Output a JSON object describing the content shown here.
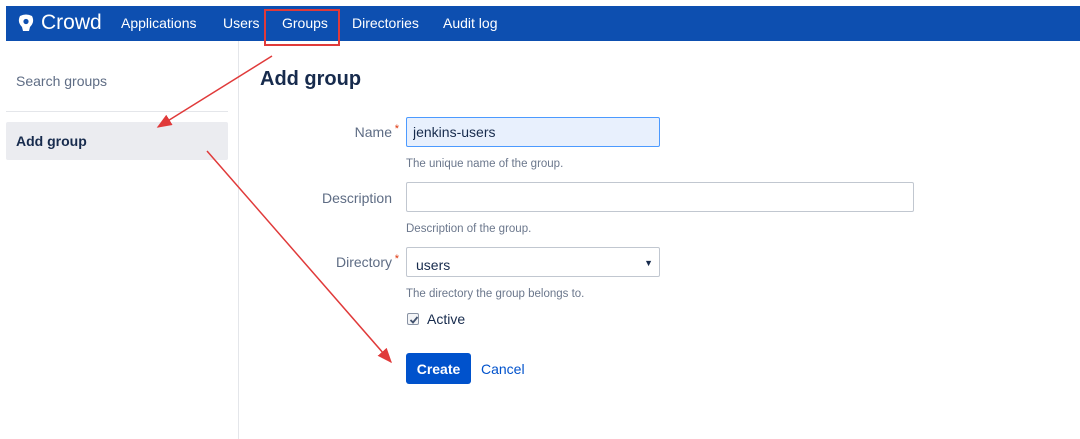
{
  "app": {
    "name": "Crowd",
    "brand_color": "#0d4fb0"
  },
  "nav": {
    "items": [
      {
        "label": "Applications",
        "icon": null
      },
      {
        "label": "Users",
        "icon": null
      },
      {
        "label": "Groups",
        "active": true
      },
      {
        "label": "Directories"
      },
      {
        "label": "Audit log"
      }
    ]
  },
  "sidebar": {
    "items": [
      {
        "label": "Search groups",
        "selected": false
      },
      {
        "label": "Add group",
        "selected": true
      }
    ]
  },
  "page": {
    "title": "Add group"
  },
  "form": {
    "name": {
      "label": "Name",
      "required": true,
      "value": "jenkins-users",
      "help": "The unique name of the group."
    },
    "description": {
      "label": "Description",
      "required": false,
      "value": "",
      "help": "Description of the group."
    },
    "directory": {
      "label": "Directory",
      "required": true,
      "selected": "users",
      "help": "The directory the group belongs to."
    },
    "active": {
      "label": "Active",
      "checked": true
    },
    "submit_label": "Create",
    "cancel_label": "Cancel"
  },
  "annotation": {
    "color": "#e03a3a"
  }
}
